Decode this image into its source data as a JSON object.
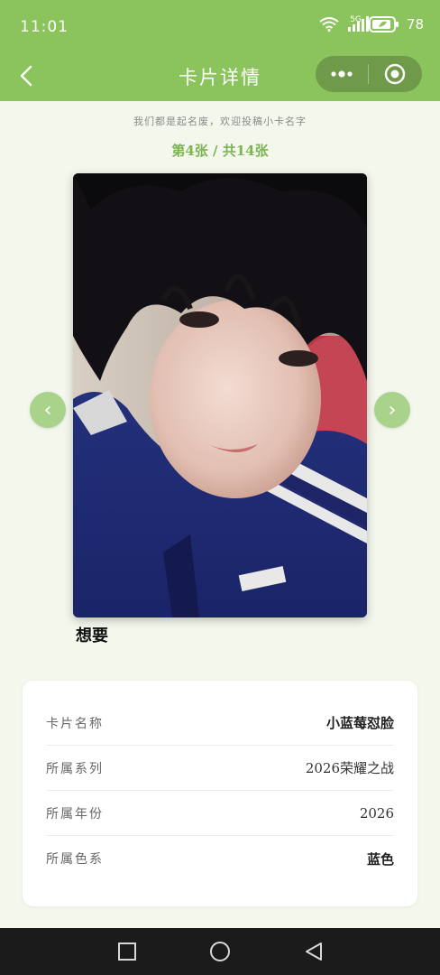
{
  "status": {
    "time": "11:01",
    "network": "5G",
    "battery": "78"
  },
  "nav": {
    "title": "卡片详情",
    "back_icon": "chevron-left-icon",
    "more_icon": "more-dots-icon",
    "close_icon": "target-close-icon"
  },
  "subtitle": "我们都是起名废，欢迎投稿小卡名字",
  "counter": "第4张 / 共14张",
  "card": {
    "caption": "想要",
    "prev_label": "‹",
    "next_label": "›"
  },
  "info": {
    "rows": [
      {
        "label": "卡片名称",
        "value": "小蓝莓怼脸"
      },
      {
        "label": "所属系列",
        "value": "2026荣耀之战"
      },
      {
        "label": "所属年份",
        "value": "2026"
      },
      {
        "label": "所属色系",
        "value": "蓝色"
      }
    ]
  },
  "colors": {
    "accent": "#8bc35c",
    "arrow": "#a9d38a",
    "background": "#f3f7ec"
  }
}
